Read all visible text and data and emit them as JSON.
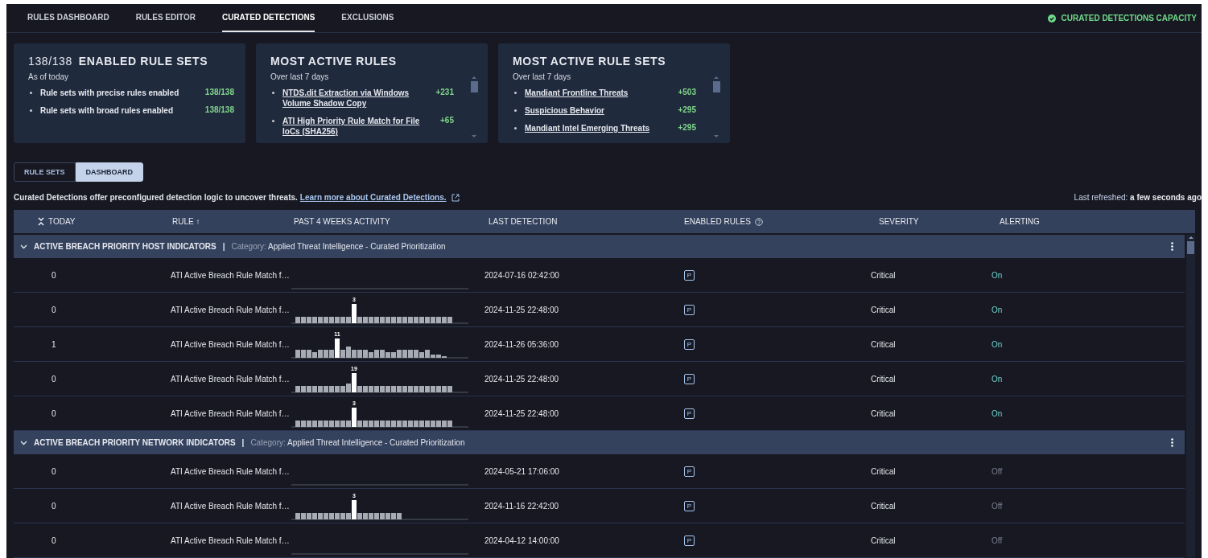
{
  "nav": {
    "tabs": [
      {
        "label": "RULES DASHBOARD",
        "selected": false
      },
      {
        "label": "RULES EDITOR",
        "selected": false
      },
      {
        "label": "CURATED DETECTIONS",
        "selected": true
      },
      {
        "label": "EXCLUSIONS",
        "selected": false
      }
    ],
    "capacity_link": "CURATED DETECTIONS CAPACITY"
  },
  "summary_cards": [
    {
      "kind": "count",
      "count": "138/138",
      "title": "ENABLED RULE SETS",
      "subtitle": "As of today",
      "items": [
        {
          "label": "Rule sets with precise rules enabled",
          "value": "138/138"
        },
        {
          "label": "Rule sets with broad rules enabled",
          "value": "138/138"
        }
      ]
    },
    {
      "kind": "links",
      "title": "MOST ACTIVE RULES",
      "subtitle": "Over last 7 days",
      "items": [
        {
          "label": "NTDS.dit Extraction via Windows Volume Shadow Copy",
          "value": "+231"
        },
        {
          "label": "ATI High Priority Rule Match for File IoCs (SHA256)",
          "value": "+65"
        }
      ]
    },
    {
      "kind": "links",
      "title": "MOST ACTIVE RULE SETS",
      "subtitle": "Over last 7 days",
      "items": [
        {
          "label": "Mandiant Frontline Threats",
          "value": "+503"
        },
        {
          "label": "Suspicious Behavior",
          "value": "+295"
        },
        {
          "label": "Mandiant Intel Emerging Threats",
          "value": "+295"
        }
      ]
    }
  ],
  "view_toggle": [
    {
      "label": "RULE SETS",
      "selected": false
    },
    {
      "label": "DASHBOARD",
      "selected": true
    }
  ],
  "intro": {
    "text": "Curated Detections offer preconfigured detection logic to uncover threats.",
    "link": "Learn more about Curated Detections."
  },
  "last_refreshed": {
    "label": "Last refreshed:",
    "value": "a few seconds ago"
  },
  "table": {
    "columns": [
      "TODAY",
      "RULE",
      "PAST 4 WEEKS ACTIVITY",
      "LAST DETECTION",
      "ENABLED RULES",
      "SEVERITY",
      "ALERTING"
    ],
    "sort_mark": "↑",
    "groups": [
      {
        "name": "ACTIVE BREACH PRIORITY HOST INDICATORS",
        "separator": "|",
        "category_label": "Category:",
        "category": "Applied Threat Intelligence - Curated Prioritization",
        "expanded": true,
        "rows": [
          {
            "today": "0",
            "rule": "ATI Active Breach Rule Match f…",
            "activity": {
              "kind": "empty"
            },
            "last_detection": "2024-07-16 02:42:00",
            "enabled": "P",
            "severity": "Critical",
            "alerting": "On",
            "alerting_on": true
          },
          {
            "today": "0",
            "rule": "ATI Active Breach Rule Match f…",
            "activity": {
              "kind": "spike",
              "peak": "3"
            },
            "last_detection": "2024-11-25 22:48:00",
            "enabled": "P",
            "severity": "Critical",
            "alerting": "On",
            "alerting_on": true
          },
          {
            "today": "1",
            "rule": "ATI Active Breach Rule Match f…",
            "activity": {
              "kind": "varied",
              "peak": "11"
            },
            "last_detection": "2024-11-26 05:36:00",
            "enabled": "P",
            "severity": "Critical",
            "alerting": "On",
            "alerting_on": true
          },
          {
            "today": "0",
            "rule": "ATI Active Breach Rule Match f…",
            "activity": {
              "kind": "bump",
              "peak": "19"
            },
            "last_detection": "2024-11-25 22:48:00",
            "enabled": "P",
            "severity": "Critical",
            "alerting": "On",
            "alerting_on": true
          },
          {
            "today": "0",
            "rule": "ATI Active Breach Rule Match f…",
            "activity": {
              "kind": "spike",
              "peak": "3"
            },
            "last_detection": "2024-11-25 22:48:00",
            "enabled": "P",
            "severity": "Critical",
            "alerting": "On",
            "alerting_on": true
          }
        ]
      },
      {
        "name": "ACTIVE BREACH PRIORITY NETWORK INDICATORS",
        "separator": "|",
        "category_label": "Category:",
        "category": "Applied Threat Intelligence - Curated Prioritization",
        "expanded": true,
        "rows": [
          {
            "today": "0",
            "rule": "ATI Active Breach Rule Match f…",
            "activity": {
              "kind": "empty"
            },
            "last_detection": "2024-05-21 17:06:00",
            "enabled": "P",
            "severity": "Critical",
            "alerting": "Off",
            "alerting_on": false
          },
          {
            "today": "0",
            "rule": "ATI Active Breach Rule Match f…",
            "activity": {
              "kind": "short",
              "peak": "3"
            },
            "last_detection": "2024-11-16 22:42:00",
            "enabled": "P",
            "severity": "Critical",
            "alerting": "Off",
            "alerting_on": false
          },
          {
            "today": "0",
            "rule": "ATI Active Breach Rule Match f…",
            "activity": {
              "kind": "empty"
            },
            "last_detection": "2024-04-12 14:00:00",
            "enabled": "P",
            "severity": "Critical",
            "alerting": "Off",
            "alerting_on": false
          }
        ]
      }
    ]
  }
}
